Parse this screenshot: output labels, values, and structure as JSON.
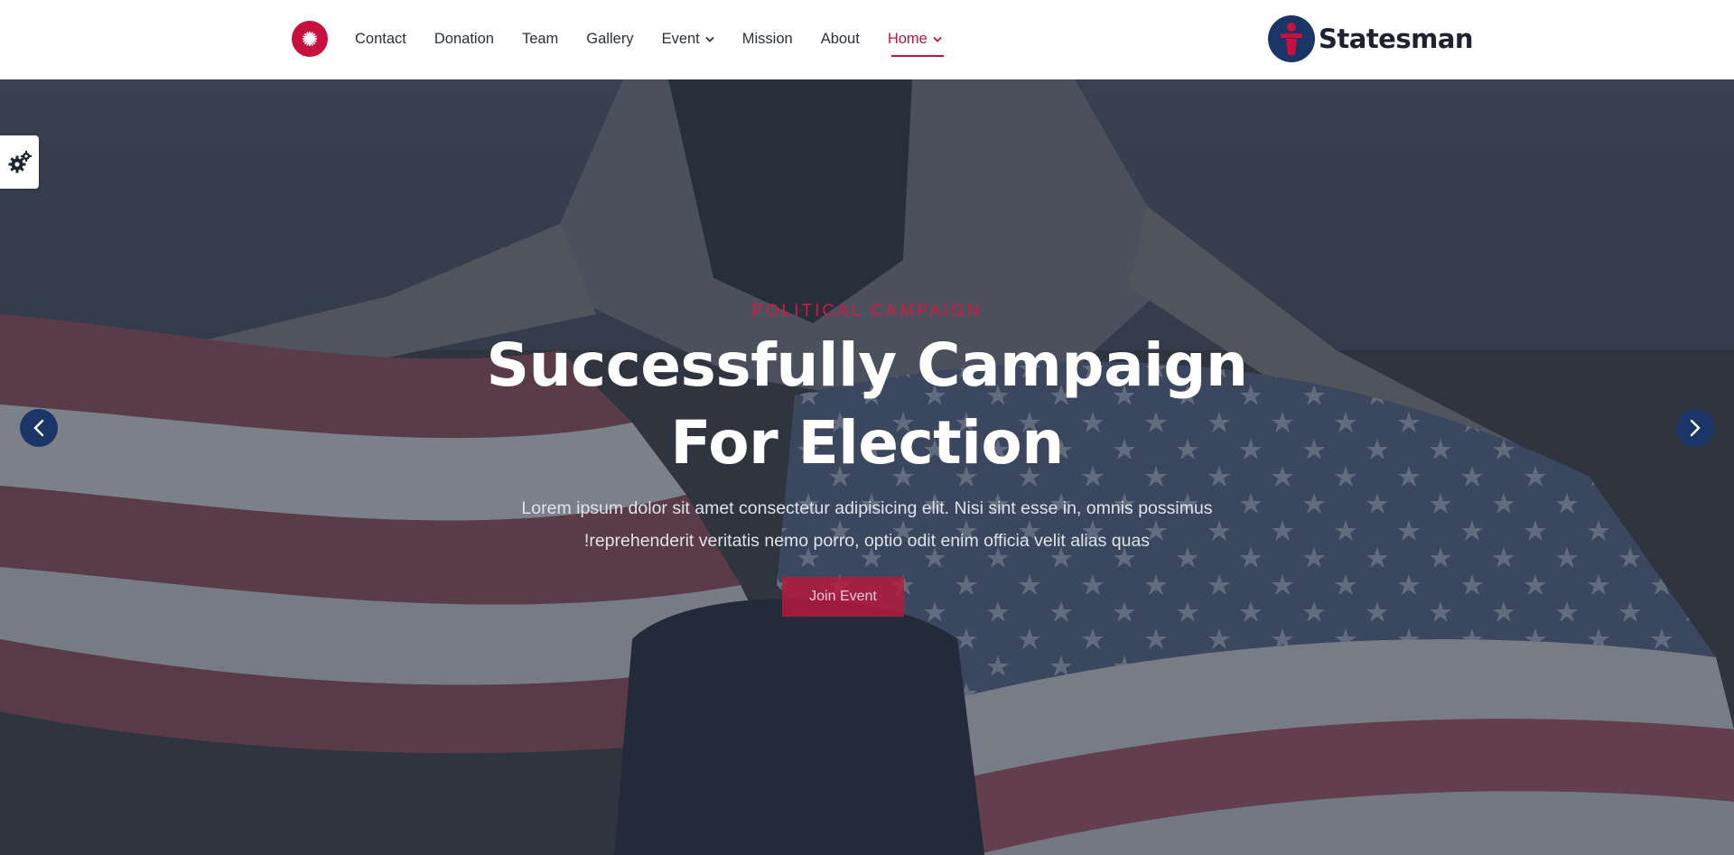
{
  "header": {
    "menu_icon": "sunburst-menu-icon",
    "nav": [
      {
        "label": "Contact",
        "has_dropdown": false
      },
      {
        "label": "Donation",
        "has_dropdown": false
      },
      {
        "label": "Team",
        "has_dropdown": false
      },
      {
        "label": "Gallery",
        "has_dropdown": false
      },
      {
        "label": "Event",
        "has_dropdown": true
      },
      {
        "label": "Mission",
        "has_dropdown": false
      },
      {
        "label": "About",
        "has_dropdown": false
      },
      {
        "label": "Home",
        "has_dropdown": true,
        "active": true
      }
    ],
    "logo": {
      "text": "Statesman",
      "icon": "podium-logo-icon"
    }
  },
  "hero": {
    "eyebrow": "POLITICAL CAMPAIGN",
    "headline_line1": "Successfully Campaign",
    "headline_line2": "For Election",
    "subtext_line1": "Lorem ipsum dolor sit amet consectetur adipisicing elit. Nisi sint esse in, omnis possimus",
    "subtext_line2": "!reprehenderit veritatis nemo porro, optio odit enim officia velit alias quas",
    "cta_label": "Join Event",
    "prev_icon": "chevron-left-icon",
    "next_icon": "chevron-right-icon",
    "background": "woman-holding-american-flag-photo"
  },
  "settings_icon": "gears-icon",
  "colors": {
    "accent": "#c8103e",
    "navy": "#1b3566",
    "nav_text": "#2b2f3a",
    "header_bg": "#ffffff"
  }
}
